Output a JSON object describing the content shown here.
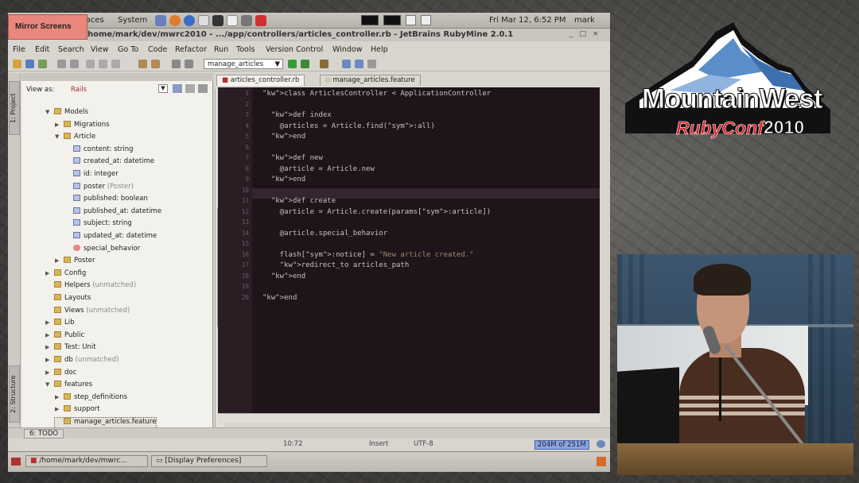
{
  "gnome_panel": {
    "menus": [
      "laces",
      "System"
    ],
    "clock": "Fri Mar 12,  6:52 PM",
    "user": "mark"
  },
  "mirror_label": "Mirror Screens",
  "window_title": "home/mark/dev/mwrc2010 - .../app/controllers/articles_controller.rb - JetBrains RubyMine 2.0.1",
  "menubar": [
    "File",
    "Edit",
    "Search",
    "View",
    "Go To",
    "Code",
    "Refactor",
    "Run",
    "Tools",
    "Version Control",
    "Window",
    "Help"
  ],
  "run_config": "manage_articles",
  "side_tabs": {
    "project": "1: Project",
    "structure": "2: Structure"
  },
  "project_panel": {
    "view_as_label": "View as:",
    "view_as_value": "Rails",
    "tree": [
      {
        "label": "Models",
        "note": "",
        "kind": "folder",
        "depth": 1,
        "toggle": "▼"
      },
      {
        "label": "Migrations",
        "note": "",
        "kind": "folder",
        "depth": 2,
        "toggle": "▶"
      },
      {
        "label": "Article",
        "note": "",
        "kind": "folder",
        "depth": 2,
        "toggle": "▼"
      },
      {
        "label": "content: string",
        "note": "",
        "kind": "field",
        "depth": 3,
        "toggle": ""
      },
      {
        "label": "created_at: datetime",
        "note": "",
        "kind": "field",
        "depth": 3,
        "toggle": ""
      },
      {
        "label": "id: integer",
        "note": "",
        "kind": "field",
        "depth": 3,
        "toggle": ""
      },
      {
        "label": "poster",
        "note": "(Poster)",
        "kind": "field",
        "depth": 3,
        "toggle": ""
      },
      {
        "label": "published: boolean",
        "note": "",
        "kind": "field",
        "depth": 3,
        "toggle": ""
      },
      {
        "label": "published_at: datetime",
        "note": "",
        "kind": "field",
        "depth": 3,
        "toggle": ""
      },
      {
        "label": "subject: string",
        "note": "",
        "kind": "field",
        "depth": 3,
        "toggle": ""
      },
      {
        "label": "updated_at: datetime",
        "note": "",
        "kind": "field",
        "depth": 3,
        "toggle": ""
      },
      {
        "label": "special_behavior",
        "note": "",
        "kind": "method",
        "depth": 3,
        "toggle": ""
      },
      {
        "label": "Poster",
        "note": "",
        "kind": "folder",
        "depth": 2,
        "toggle": "▶"
      },
      {
        "label": "Config",
        "note": "",
        "kind": "folder",
        "depth": 1,
        "toggle": "▶"
      },
      {
        "label": "Helpers",
        "note": "(unmatched)",
        "kind": "folder",
        "depth": 1,
        "toggle": ""
      },
      {
        "label": "Layouts",
        "note": "",
        "kind": "folder",
        "depth": 1,
        "toggle": ""
      },
      {
        "label": "Views",
        "note": "(unmatched)",
        "kind": "folder",
        "depth": 1,
        "toggle": ""
      },
      {
        "label": "Lib",
        "note": "",
        "kind": "folder",
        "depth": 1,
        "toggle": "▶"
      },
      {
        "label": "Public",
        "note": "",
        "kind": "folder",
        "depth": 1,
        "toggle": "▶"
      },
      {
        "label": "Test: Unit",
        "note": "",
        "kind": "folder",
        "depth": 1,
        "toggle": "▶"
      },
      {
        "label": "db",
        "note": "(unmatched)",
        "kind": "folder",
        "depth": 1,
        "toggle": "▶"
      },
      {
        "label": "doc",
        "note": "",
        "kind": "folder",
        "depth": 1,
        "toggle": "▶"
      },
      {
        "label": "features",
        "note": "",
        "kind": "folder",
        "depth": 1,
        "toggle": "▼"
      },
      {
        "label": "step_definitions",
        "note": "",
        "kind": "folder",
        "depth": 2,
        "toggle": "▶"
      },
      {
        "label": "support",
        "note": "",
        "kind": "folder",
        "depth": 2,
        "toggle": "▶"
      },
      {
        "label": "manage_articles.feature",
        "note": "",
        "kind": "folder",
        "depth": 2,
        "toggle": ""
      }
    ]
  },
  "editor_tabs": [
    "articles_controller.rb",
    "manage_articles.feature"
  ],
  "code_lines": [
    {
      "n": "1",
      "text": "class ArticlesController < ApplicationController"
    },
    {
      "n": "2",
      "text": ""
    },
    {
      "n": "3",
      "text": "  def index"
    },
    {
      "n": "4",
      "text": "    @articles = Article.find(:all)"
    },
    {
      "n": "5",
      "text": "  end"
    },
    {
      "n": "6",
      "text": ""
    },
    {
      "n": "7",
      "text": "  def new"
    },
    {
      "n": "8",
      "text": "    @article = Article.new"
    },
    {
      "n": "9",
      "text": "  end"
    },
    {
      "n": "10",
      "text": ""
    },
    {
      "n": "11",
      "text": "  def create"
    },
    {
      "n": "12",
      "text": "    @article = Article.create(params[:article])"
    },
    {
      "n": "13",
      "text": ""
    },
    {
      "n": "14",
      "text": "    @article.special_behavior"
    },
    {
      "n": "15",
      "text": ""
    },
    {
      "n": "16",
      "text": "    flash[:notice] = \"New article created.\""
    },
    {
      "n": "17",
      "text": "    redirect_to articles_path"
    },
    {
      "n": "18",
      "text": "  end"
    },
    {
      "n": "19",
      "text": ""
    },
    {
      "n": "20",
      "text": "end"
    }
  ],
  "todo_tab": "6: TODO",
  "status": {
    "position": "10:72",
    "mode": "Insert",
    "encoding": "UTF-8",
    "memory": "204M of 251M"
  },
  "taskbar": [
    "/home/mark/dev/mwrc...",
    "[Display Preferences]"
  ],
  "logo": {
    "line1": "MountainWest",
    "line2a": "RubyConf",
    "line2b": "2010"
  },
  "colors": {
    "logo_red": "#d8262b",
    "mirror_bg": "#e9877d",
    "editor_bg": "#1f141a"
  }
}
